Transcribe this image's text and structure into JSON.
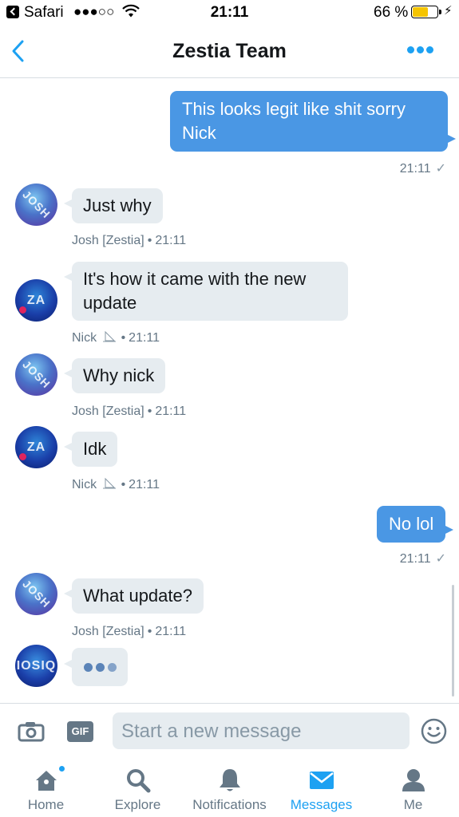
{
  "status_bar": {
    "back_app": "Safari",
    "signal": "●●●○○",
    "time": "21:11",
    "battery_pct": "66 %",
    "battery_level": 0.66
  },
  "header": {
    "title": "Zestia Team"
  },
  "messages": [
    {
      "direction": "out",
      "lines": [
        "This looks legit like shit sorry",
        "Nick"
      ],
      "time": "21:11"
    },
    {
      "direction": "in",
      "avatar": "josh",
      "text": "Just why",
      "sender": "Josh [Zestia]",
      "time": "21:11"
    },
    {
      "direction": "in",
      "avatar": "nick",
      "lines": [
        "It's how it came with the new",
        "update"
      ],
      "sender": "Nick",
      "time": "21:11"
    },
    {
      "direction": "in",
      "avatar": "josh",
      "text": "Why nick",
      "sender": "Josh [Zestia]",
      "time": "21:11"
    },
    {
      "direction": "in",
      "avatar": "nick",
      "text": "Idk",
      "sender": "Nick",
      "time": "21:11"
    },
    {
      "direction": "out",
      "text": "No lol",
      "time": "21:11"
    },
    {
      "direction": "in",
      "avatar": "josh",
      "text": "What update?",
      "sender": "Josh [Zestia]",
      "time": "21:11"
    }
  ],
  "avatars": {
    "josh": "JOSH",
    "nick": "ZA",
    "iosiq": "IOSIQ"
  },
  "composer": {
    "gif_label": "GIF",
    "placeholder": "Start a new message"
  },
  "tabs": [
    {
      "label": "Home",
      "icon": "home-icon"
    },
    {
      "label": "Explore",
      "icon": "search-icon"
    },
    {
      "label": "Notifications",
      "icon": "bell-icon"
    },
    {
      "label": "Messages",
      "icon": "envelope-icon"
    },
    {
      "label": "Me",
      "icon": "person-icon"
    }
  ],
  "colors": {
    "accent": "#1da1f2",
    "outgoing_bubble": "#4a97e4",
    "incoming_bubble": "#e6ecf0"
  }
}
